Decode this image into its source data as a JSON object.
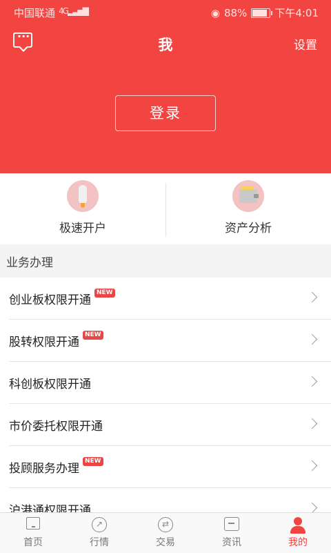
{
  "status_bar": {
    "carrier": "中国联通",
    "network": "4G",
    "battery": "88%",
    "battery_level": 0.88,
    "time": "下午4:01"
  },
  "header": {
    "title": "我",
    "settings": "设置",
    "login": "登录"
  },
  "quick_actions": [
    {
      "label": "极速开户",
      "icon": "rocket-icon"
    },
    {
      "label": "资产分析",
      "icon": "wallet-icon"
    }
  ],
  "section": {
    "title": "业务办理"
  },
  "services": [
    {
      "label": "创业板权限开通",
      "badge": "NEW"
    },
    {
      "label": "股转权限开通",
      "badge": "NEW"
    },
    {
      "label": "科创板权限开通",
      "badge": ""
    },
    {
      "label": "市价委托权限开通",
      "badge": ""
    },
    {
      "label": "投顾服务办理",
      "badge": "NEW"
    },
    {
      "label": "沪港通权限开通",
      "badge": ""
    }
  ],
  "tabs": [
    {
      "label": "首页",
      "icon": "home-icon"
    },
    {
      "label": "行情",
      "icon": "market-icon"
    },
    {
      "label": "交易",
      "icon": "trade-icon"
    },
    {
      "label": "资讯",
      "icon": "news-icon"
    },
    {
      "label": "我的",
      "icon": "user-icon",
      "active": true
    }
  ],
  "colors": {
    "accent": "#f24440",
    "badge": "#e94747"
  }
}
